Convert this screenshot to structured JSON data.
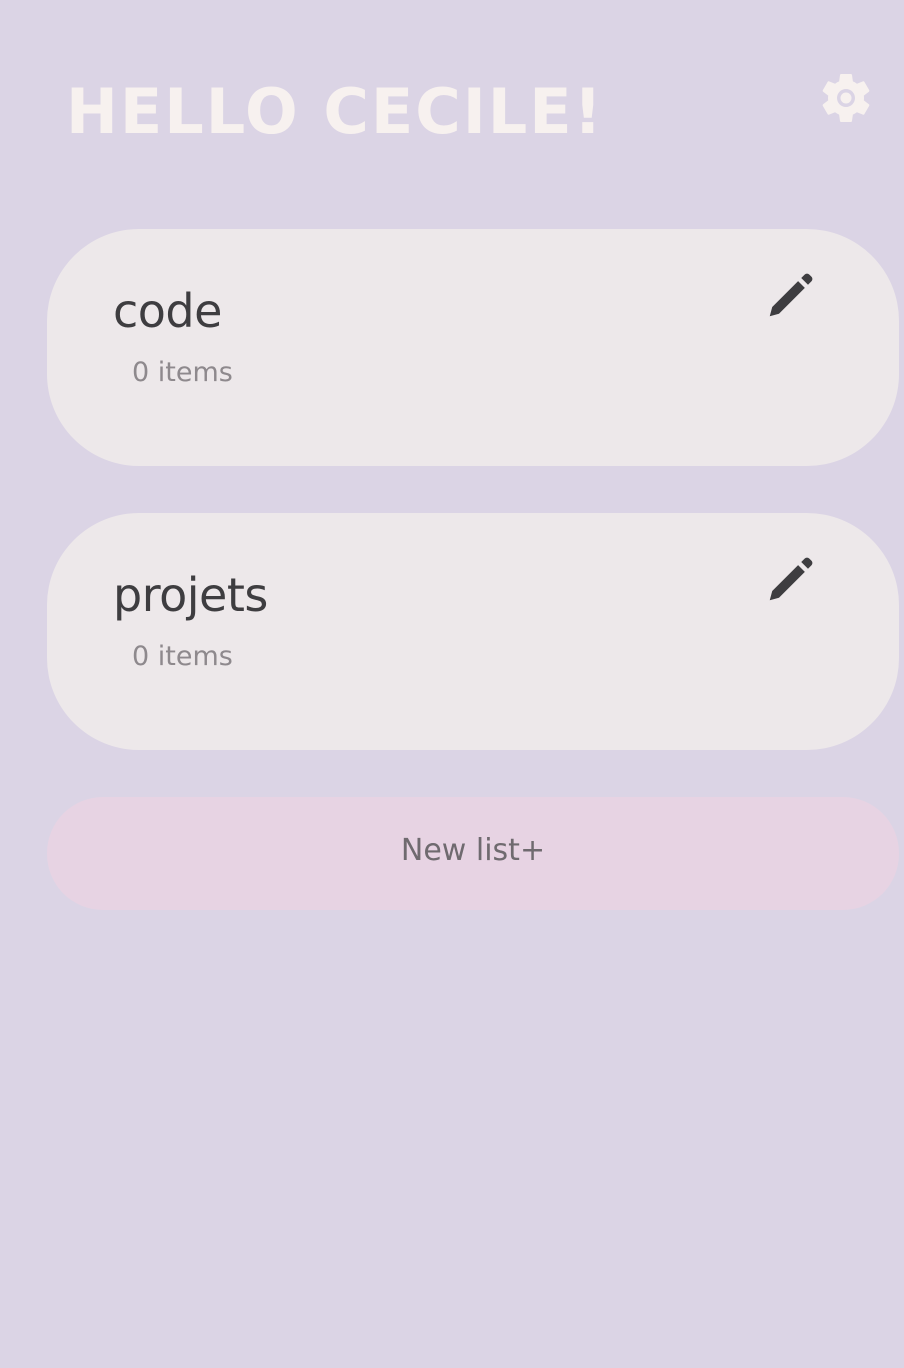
{
  "header": {
    "greeting": "HELLO CECILE!",
    "settings_icon": "gear-icon"
  },
  "lists": [
    {
      "title": "code",
      "count_label": "0 items",
      "edit_icon": "pencil-icon"
    },
    {
      "title": "projets",
      "count_label": "0 items",
      "edit_icon": "pencil-icon"
    }
  ],
  "new_list": {
    "label": "New list+"
  },
  "colors": {
    "background": "#dbd4e5",
    "greeting": "#f7f1ef",
    "card": "#ede8ea",
    "card_title": "#3e3d40",
    "card_count": "#8e898d",
    "new_list_button": "#e7d3e3",
    "new_list_text": "#6f6a6f",
    "icon_dark": "#3e3d40"
  }
}
